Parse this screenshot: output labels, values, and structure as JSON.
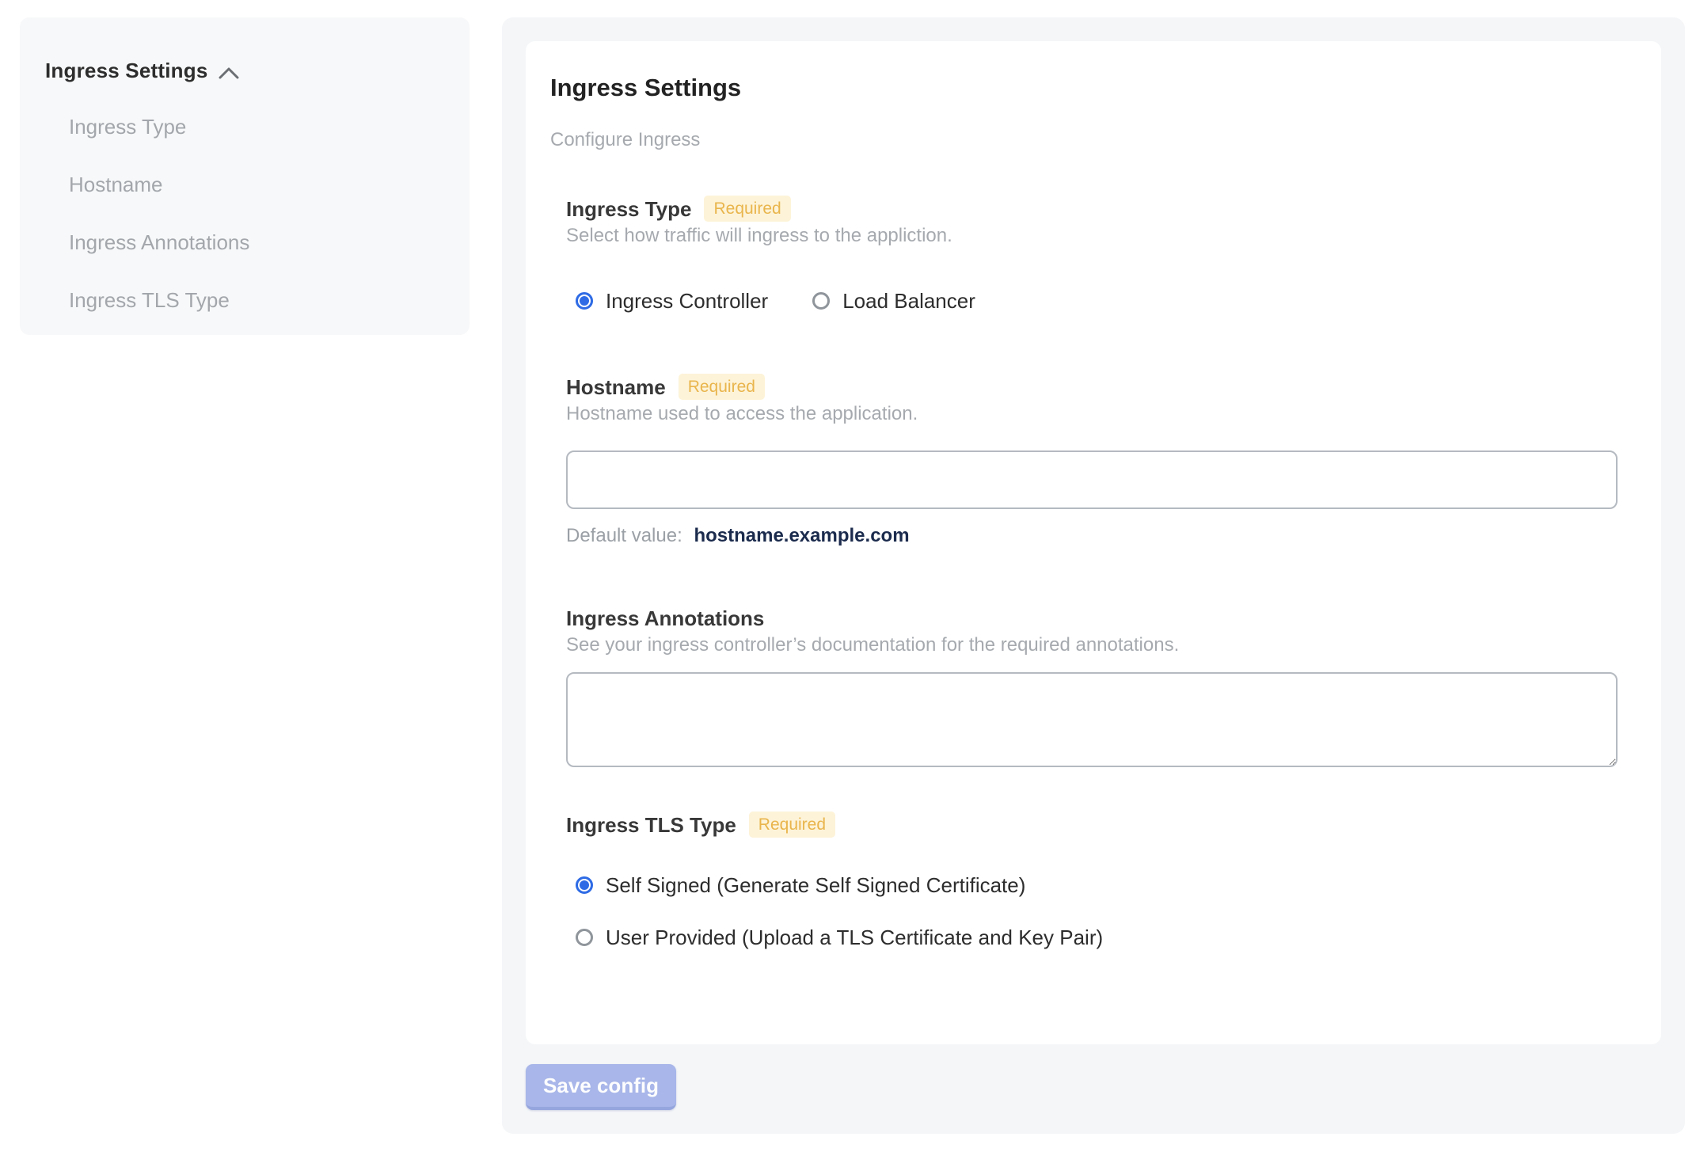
{
  "sidebar": {
    "title": "Ingress Settings",
    "collapse_icon": "chevron-up-icon",
    "items": [
      {
        "label": "Ingress Type"
      },
      {
        "label": "Hostname"
      },
      {
        "label": "Ingress Annotations"
      },
      {
        "label": "Ingress TLS Type"
      }
    ]
  },
  "panel": {
    "title": "Ingress Settings",
    "subtitle": "Configure Ingress",
    "sections": {
      "ingress_type": {
        "label": "Ingress Type",
        "badge": "Required",
        "description": "Select how traffic will ingress to the appliction.",
        "options": [
          {
            "label": "Ingress Controller",
            "selected": true
          },
          {
            "label": "Load Balancer",
            "selected": false
          }
        ]
      },
      "hostname": {
        "label": "Hostname",
        "badge": "Required",
        "description": "Hostname used to access the application.",
        "input_value": "",
        "default_value_label": "Default value:",
        "default_value": "hostname.example.com"
      },
      "annotations": {
        "label": "Ingress Annotations",
        "description": "See your ingress controller’s documentation for the required annotations.",
        "textarea_value": ""
      },
      "tls": {
        "label": "Ingress TLS Type",
        "badge": "Required",
        "options": [
          {
            "label": "Self Signed (Generate Self Signed Certificate)",
            "selected": true
          },
          {
            "label": "User Provided (Upload a TLS Certificate and Key Pair)",
            "selected": false
          }
        ]
      }
    },
    "save_button_label": "Save config"
  },
  "colors": {
    "accent_blue": "#2e6be5",
    "badge_bg": "#fdf3d8",
    "badge_text": "#e9b54c",
    "save_button_bg": "#a8b6e9",
    "default_value_text": "#1b2b4d",
    "panel_bg": "#f4f6f8",
    "sidebar_bg": "#f7f8f9"
  }
}
